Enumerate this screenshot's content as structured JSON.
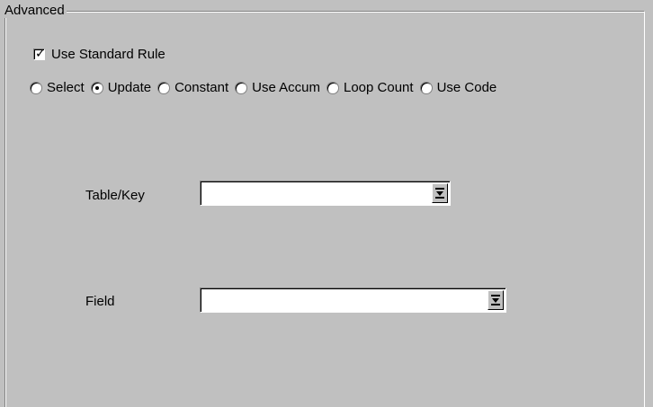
{
  "group": {
    "title": "Advanced"
  },
  "checkbox": {
    "label": "Use Standard Rule",
    "checked": true
  },
  "radios": [
    {
      "label": "Select",
      "selected": false
    },
    {
      "label": "Update",
      "selected": true
    },
    {
      "label": "Constant",
      "selected": false
    },
    {
      "label": "Use Accum",
      "selected": false
    },
    {
      "label": "Loop Count",
      "selected": false
    },
    {
      "label": "Use Code",
      "selected": false
    }
  ],
  "fields": {
    "table_key": {
      "label": "Table/Key",
      "value": ""
    },
    "field": {
      "label": "Field",
      "value": ""
    }
  },
  "icons": {
    "dropdown": "dropdown-arrow-icon"
  }
}
